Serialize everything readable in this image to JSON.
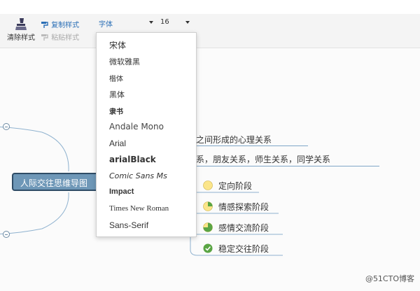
{
  "toolbar": {
    "clear_format": "清除样式",
    "copy_format": "复制样式",
    "paste_format": "粘贴样式",
    "font_select_value": "字体",
    "size_select_value": "16"
  },
  "font_dropdown": {
    "options": [
      "宋体",
      "微软雅黑",
      "楷体",
      "黑体",
      "隶书",
      "Andale Mono",
      "Arial",
      "arialBlack",
      "Comic Sans Ms",
      "Impact",
      "Times New Roman",
      "Sans-Serif"
    ]
  },
  "mindmap": {
    "root": "人际交往思维导图",
    "topic_1": "人与人之间形成的心理关系",
    "topic_2": "亲属关系，朋友关系，师生关系，同学关系",
    "stages": [
      {
        "label": "定向阶段",
        "progress": 0
      },
      {
        "label": "情感探索阶段",
        "progress": 0.25
      },
      {
        "label": "感情交流阶段",
        "progress": 0.75
      },
      {
        "label": "稳定交往阶段",
        "progress": 1
      }
    ]
  },
  "colors": {
    "pie_fill": "#fbe58a",
    "pie_done": "#5aa544",
    "root_fill": "#6e97b7",
    "accent": "#2b6fb6"
  },
  "watermark": "@51CTO博客"
}
